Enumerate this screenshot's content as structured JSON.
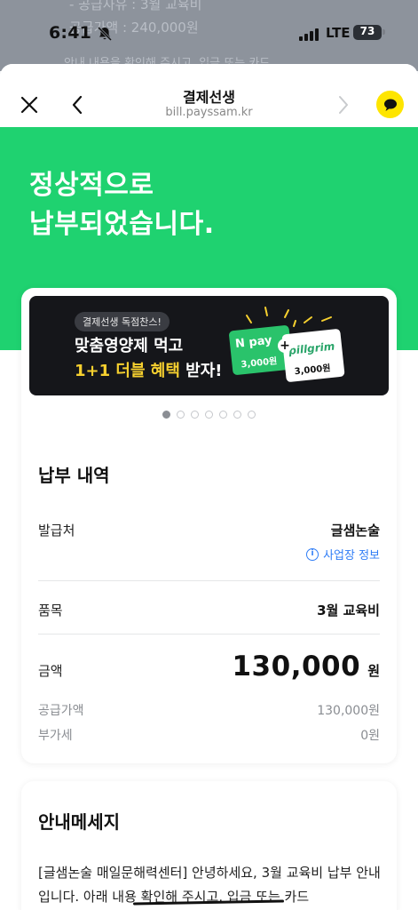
{
  "status_bar": {
    "time": "6:41",
    "network": "LTE",
    "battery": "73"
  },
  "background": {
    "ghost_line1": "- 공급사유 : 3월 교육비",
    "ghost_line2": "공급가액 : 240,000원",
    "ghost_line3": "안내 내용을 확인해 주시고, 입금 또는 카드"
  },
  "nav": {
    "title": "결제선생",
    "url": "bill.payssam.kr"
  },
  "hero": {
    "line1": "정상적으로",
    "line2": "납부되었습니다."
  },
  "banner": {
    "tag": "결제선생 독점찬스!",
    "line1": "맞춤영양제 먹고",
    "line2_highlight": "1+1 더블 혜택",
    "line2_rest": " 받자!",
    "coupon1_brand": "N pay",
    "coupon1_amount": "3,000원",
    "coupon2_brand": "pillgrim",
    "coupon2_amount": "3,000원",
    "pages": 7,
    "active_page": 1
  },
  "payment": {
    "section_title": "납부 내역",
    "issuer_label": "발급처",
    "issuer_value": "글샘논술",
    "business_info_link": "사업장 정보",
    "item_label": "품목",
    "item_value": "3월 교육비",
    "amount_label": "금액",
    "amount_value": "130,000",
    "amount_unit": "원",
    "supply_label": "공급가액",
    "supply_value": "130,000원",
    "vat_label": "부가세",
    "vat_value": "0원"
  },
  "message": {
    "section_title": "안내메세지",
    "body": "[글샘논술 매일문해력센터] 안녕하세요, 3월 교육비 납부 안내입니다. 아래 내용 확인해 주시고, 입금 또는 카드"
  },
  "colors": {
    "hero_green": "#1fd270",
    "link_blue": "#2f7df6",
    "kakao_yellow": "#fee500",
    "banner_bg": "#15161a"
  }
}
